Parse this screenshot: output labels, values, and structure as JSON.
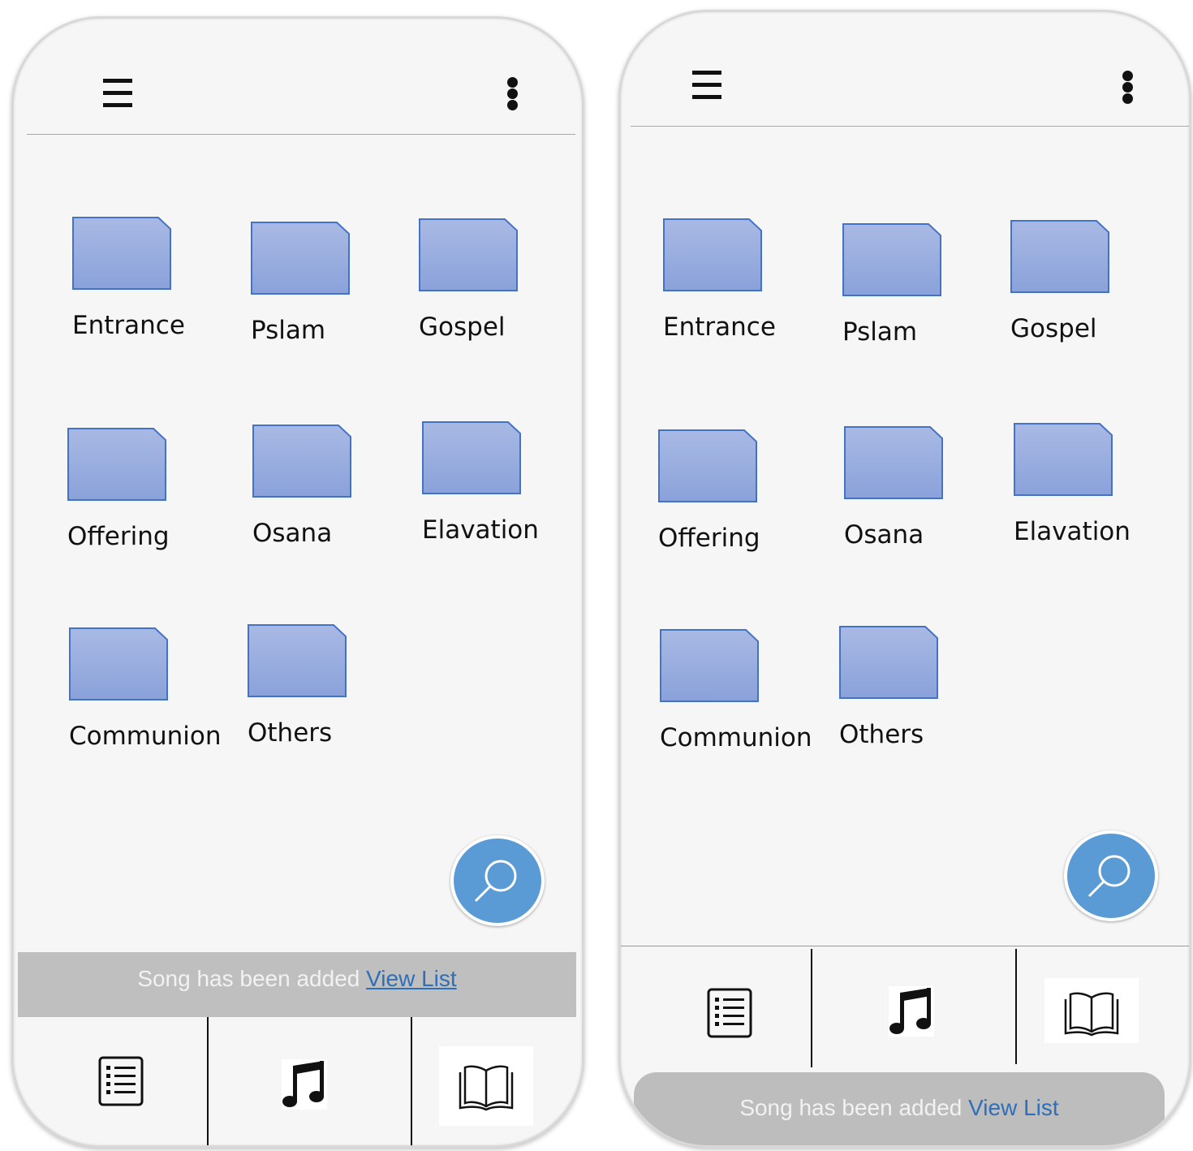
{
  "screens": [
    {
      "folders": [
        {
          "label": "Entrance"
        },
        {
          "label": "Pslam"
        },
        {
          "label": "Gospel"
        },
        {
          "label": "Offering"
        },
        {
          "label": "Osana"
        },
        {
          "label": "Elavation"
        },
        {
          "label": "Communion"
        },
        {
          "label": "Others"
        }
      ],
      "snackbar": {
        "message": "Song has been added",
        "action": "View List"
      },
      "bottom_nav": [
        "list-icon",
        "music-note-icon",
        "book-icon"
      ]
    },
    {
      "folders": [
        {
          "label": "Entrance"
        },
        {
          "label": "Pslam"
        },
        {
          "label": "Gospel"
        },
        {
          "label": "Offering"
        },
        {
          "label": "Osana"
        },
        {
          "label": "Elavation"
        },
        {
          "label": "Communion"
        },
        {
          "label": "Others"
        }
      ],
      "snackbar": {
        "message": "Song has been added",
        "action": "View List"
      },
      "bottom_nav": [
        "list-icon",
        "music-note-icon",
        "book-icon"
      ]
    }
  ],
  "colors": {
    "folder_fill": "#8ea6dc",
    "folder_stroke": "#4472c4",
    "fab_fill": "#5b9bd5",
    "snackbar_bg": "#bfbfbf",
    "link": "#2f6eb8"
  }
}
